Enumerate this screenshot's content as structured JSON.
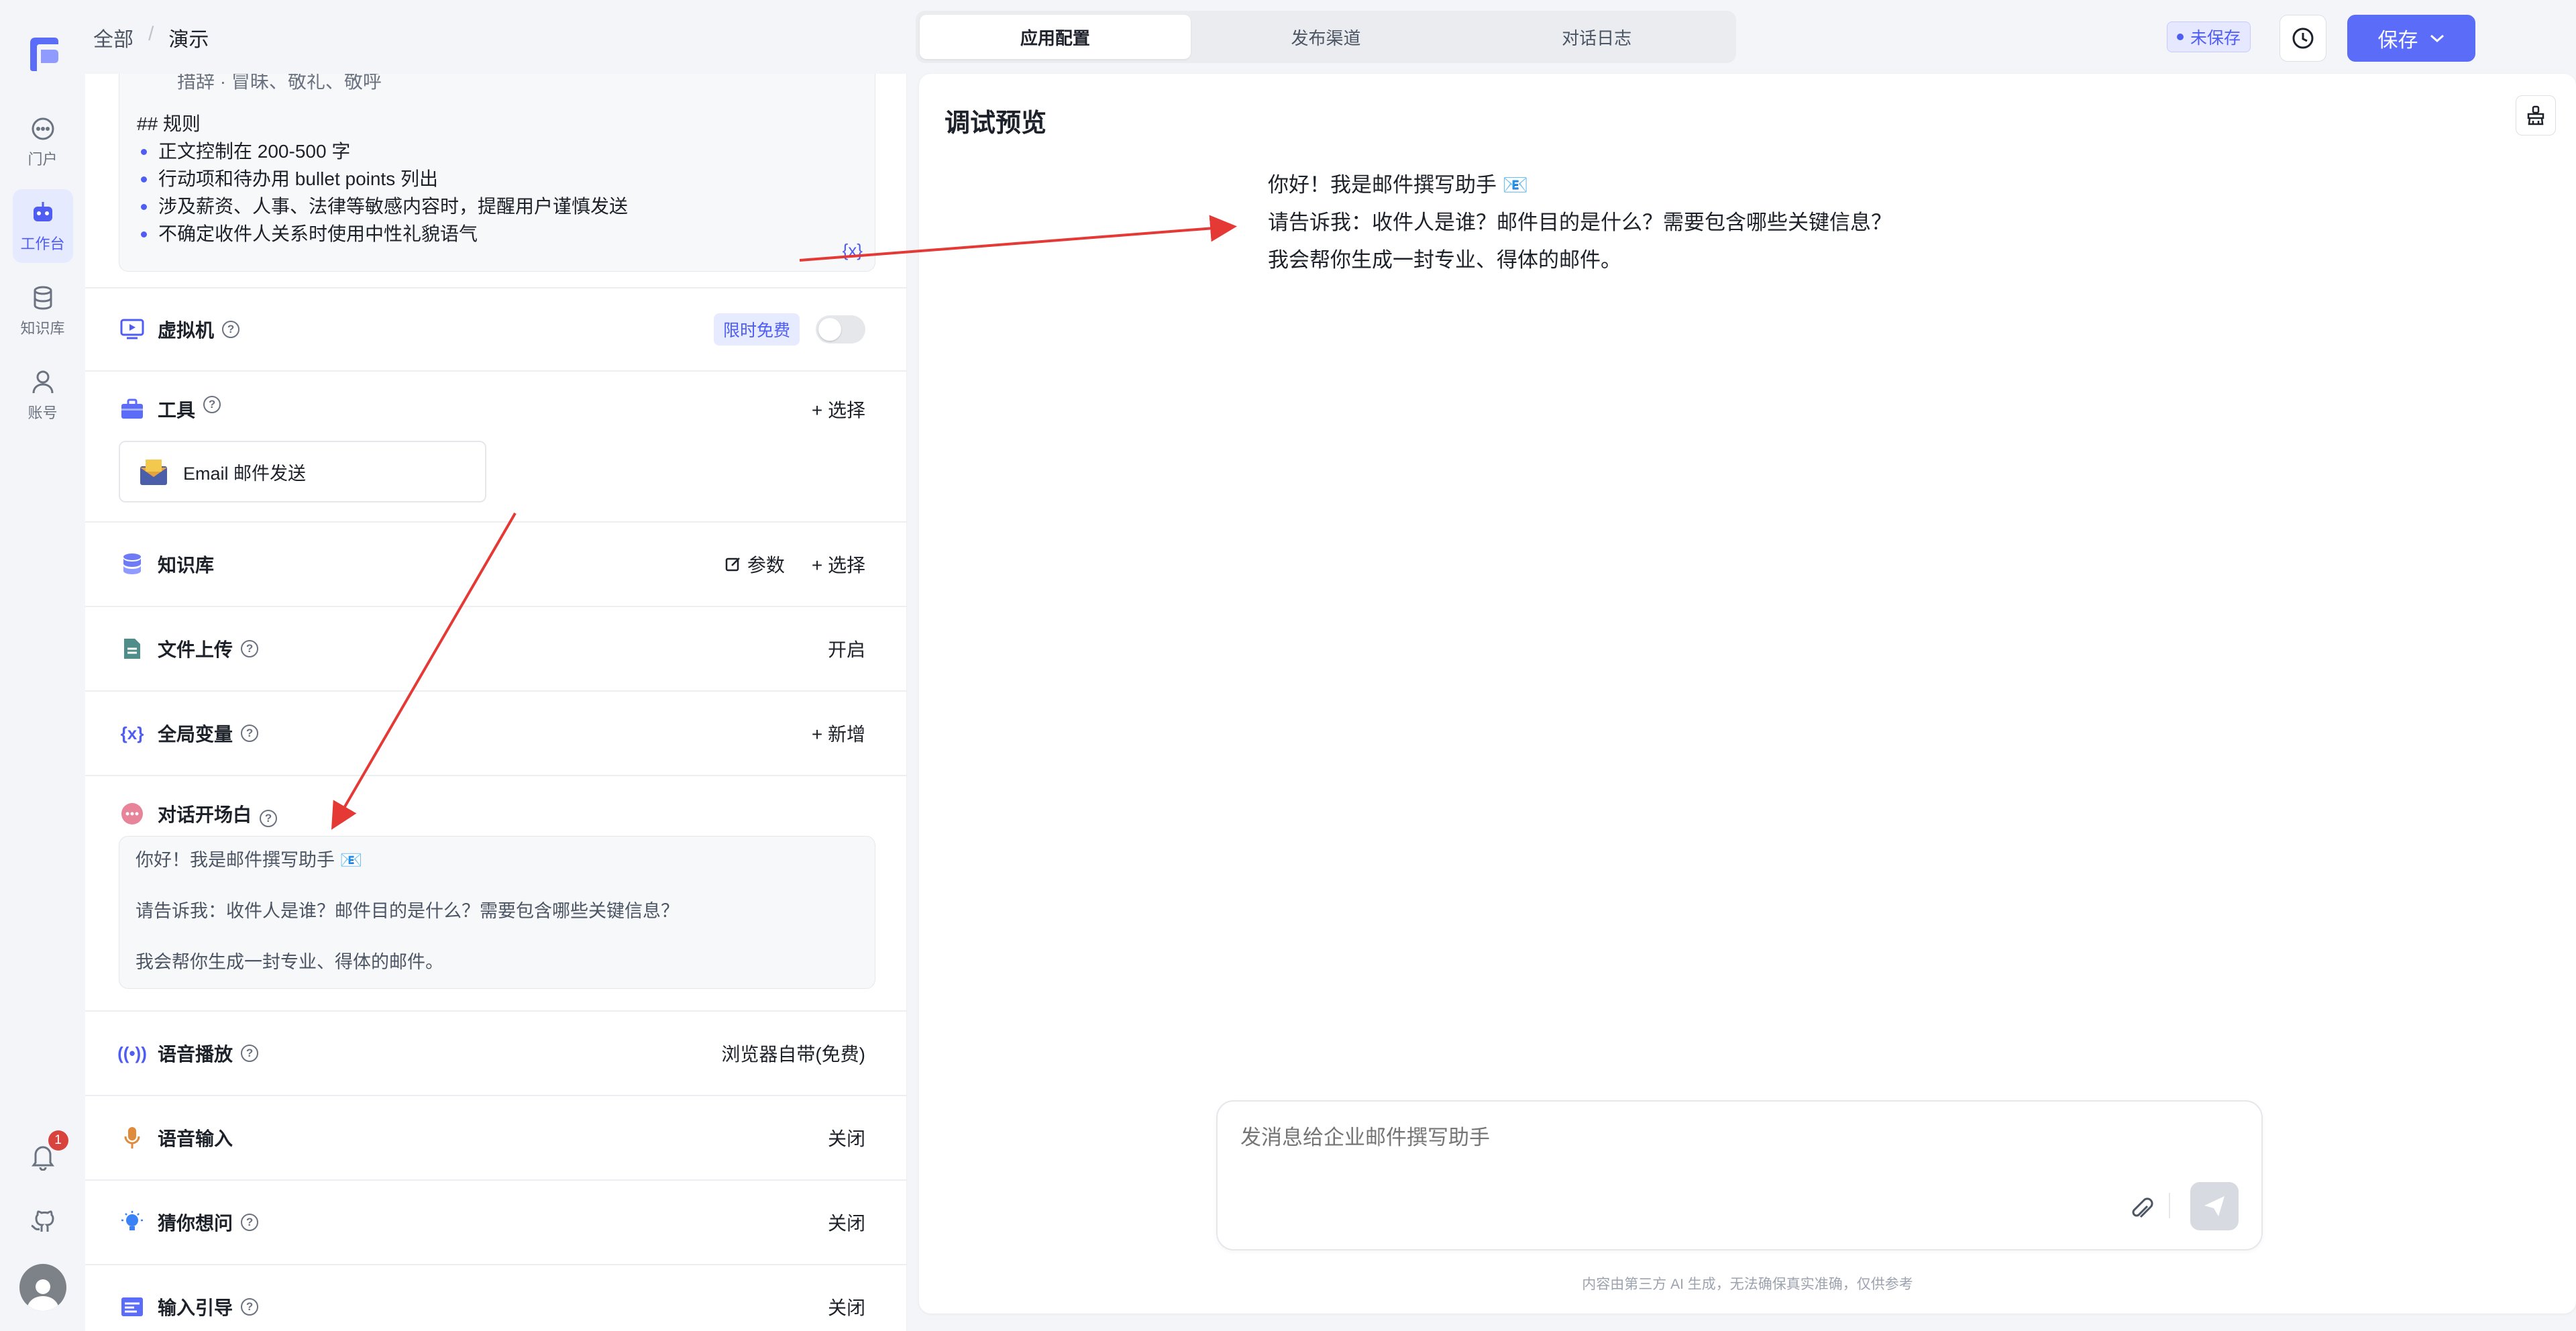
{
  "breadcrumb": {
    "root": "全部",
    "sep": "/",
    "current": "演示"
  },
  "nav": {
    "items": [
      {
        "label": "门户",
        "icon": "chat-bubble-icon"
      },
      {
        "label": "工作台",
        "icon": "robot-icon",
        "active": true
      },
      {
        "label": "知识库",
        "icon": "database-icon"
      },
      {
        "label": "账号",
        "icon": "user-icon"
      }
    ],
    "notification_count": "1"
  },
  "tabs": [
    {
      "label": "应用配置",
      "active": true
    },
    {
      "label": "发布渠道"
    },
    {
      "label": "对话日志"
    }
  ],
  "header": {
    "unsaved": "未保存",
    "save": "保存"
  },
  "prompt": {
    "cut_line": "措辞 · 冒昧、敬礼、敬呼",
    "rules_header": "## 规则",
    "rules": [
      "正文控制在 200-500 字",
      "行动项和待办用 bullet points 列出",
      "涉及薪资、人事、法律等敏感内容时，提醒用户谨慎发送",
      "不确定收件人关系时使用中性礼貌语气"
    ],
    "var_icon": "{x}"
  },
  "sections": {
    "vm": {
      "label": "虚拟机",
      "tag": "限时免费"
    },
    "tools": {
      "label": "工具",
      "action": "+ 选择",
      "tool_name": "Email 邮件发送"
    },
    "kb": {
      "label": "知识库",
      "param": "参数",
      "action": "+ 选择"
    },
    "upload": {
      "label": "文件上传",
      "value": "开启"
    },
    "vars": {
      "label": "全局变量",
      "action": "+ 新增"
    },
    "greeting": {
      "label": "对话开场白"
    },
    "tts": {
      "label": "语音播放",
      "value": "浏览器自带(免费)"
    },
    "asr": {
      "label": "语音输入",
      "value": "关闭"
    },
    "guess": {
      "label": "猜你想问",
      "value": "关闭"
    },
    "guide": {
      "label": "输入引导",
      "value": "关闭"
    }
  },
  "greeting_lines": [
    "你好！我是邮件撰写助手 📧",
    "请告诉我：收件人是谁？邮件目的是什么？需要包含哪些关键信息？",
    "我会帮你生成一封专业、得体的邮件。"
  ],
  "preview": {
    "title": "调试预览",
    "placeholder": "发消息给企业邮件撰写助手",
    "disclaimer": "内容由第三方 AI 生成，无法确保真实准确，仅供参考"
  },
  "colors": {
    "accent": "#4f5df2",
    "arrow": "#e53935"
  }
}
